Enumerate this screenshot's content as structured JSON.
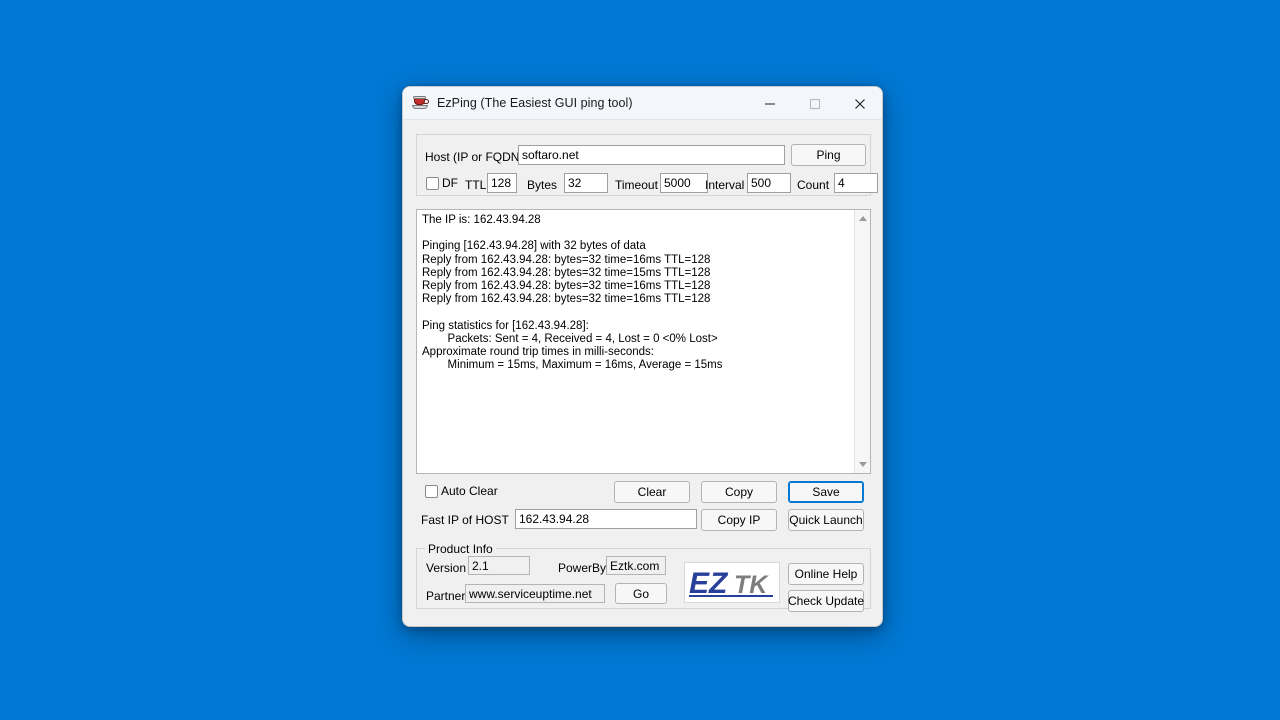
{
  "window": {
    "title": "EzPing (The Easiest GUI ping tool)",
    "icon": "coffee-cup-icon",
    "controls": {
      "minimize": "minimize-icon",
      "maximize": "maximize-icon",
      "close": "close-icon"
    }
  },
  "host_panel": {
    "host_label": "Host (IP or FQDN)",
    "host_value": "softaro.net",
    "ping_button": "Ping",
    "df_label": "DF",
    "df_checked": false,
    "ttl_label": "TTL",
    "ttl_value": "128",
    "bytes_label": "Bytes",
    "bytes_value": "32",
    "timeout_label": "Timeout",
    "timeout_value": "5000",
    "interval_label": "Interval",
    "interval_value": "500",
    "count_label": "Count",
    "count_value": "4"
  },
  "output": {
    "text": "The IP is: 162.43.94.28\n\nPinging [162.43.94.28] with 32 bytes of data\nReply from 162.43.94.28: bytes=32 time=16ms TTL=128\nReply from 162.43.94.28: bytes=32 time=15ms TTL=128\nReply from 162.43.94.28: bytes=32 time=16ms TTL=128\nReply from 162.43.94.28: bytes=32 time=16ms TTL=128\n\nPing statistics for [162.43.94.28]:\n        Packets: Sent = 4, Received = 4, Lost = 0 <0% Lost>\nApproximate round trip times in milli-seconds:\n        Minimum = 15ms, Maximum = 16ms, Average = 15ms",
    "scroll_up_icon": "triangle-up-icon",
    "scroll_down_icon": "triangle-down-icon"
  },
  "actions": {
    "auto_clear_label": "Auto Clear",
    "auto_clear_checked": false,
    "clear_button": "Clear",
    "copy_button": "Copy",
    "save_button": "Save",
    "fast_ip_label": "Fast IP of HOST",
    "fast_ip_value": "162.43.94.28",
    "copy_ip_button": "Copy IP",
    "quick_launch_button": "Quick Launch"
  },
  "product_info": {
    "legend": "Product Info",
    "version_label": "Version",
    "version_value": "2.1",
    "powerby_label": "PowerBy",
    "powerby_value": "Eztk.com",
    "partner_label": "Partner",
    "partner_value": "www.serviceuptime.net",
    "go_button": "Go",
    "logo_primary": "EZ",
    "logo_secondary": "TK",
    "online_help_button": "Online Help",
    "check_update_button": "Check Update"
  },
  "colors": {
    "desktop": "#0078d4",
    "window_bg": "#f0f0f0",
    "titlebar_bg": "#f3f6fb",
    "accent_focus": "#0078d4",
    "logo_blue": "#28409a",
    "logo_gray": "#7d7d7d"
  }
}
